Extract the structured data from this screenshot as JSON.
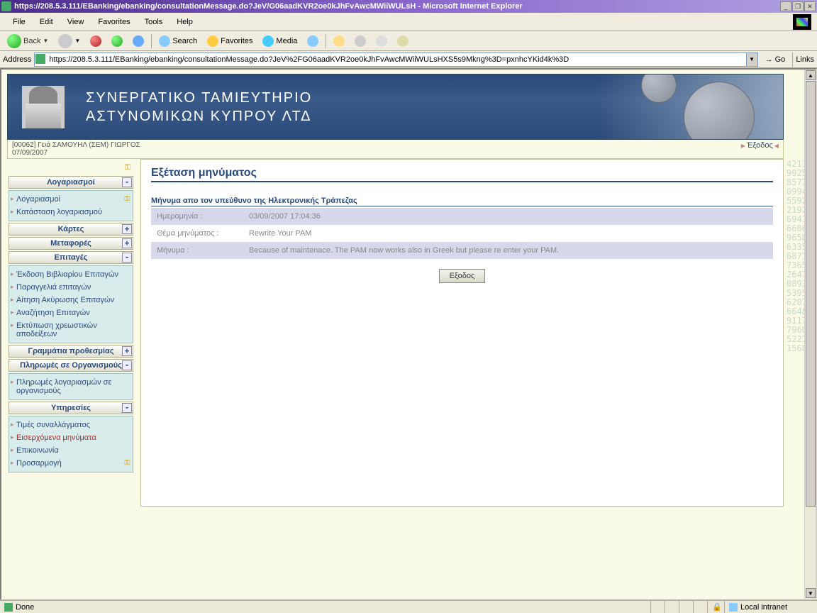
{
  "window": {
    "title": "https://208.5.3.111/EBanking/ebanking/consultationMessage.do?JeV/G06aadKVR2oe0kJhFvAwcMWiiWULsH - Microsoft Internet Explorer"
  },
  "menubar": [
    "File",
    "Edit",
    "View",
    "Favorites",
    "Tools",
    "Help"
  ],
  "toolbar": {
    "back": "Back",
    "search": "Search",
    "favorites": "Favorites",
    "media": "Media"
  },
  "addressbar": {
    "label": "Address",
    "url": "https://208.5.3.111/EBanking/ebanking/consultationMessage.do?JeV%2FG06aadKVR2oe0kJhFvAwcMWiiWULsHXS5s9Mkng%3D=pxnhcYKid4k%3D",
    "go": "Go",
    "links": "Links"
  },
  "banner": {
    "line1": "ΣΥΝΕΡΓΑΤΙΚΟ ΤΑΜΙΕΥΤΗΡΙΟ",
    "line2": "ΑΣΤΥΝΟΜΙΚΩΝ ΚΥΠΡΟΥ ΛΤΔ"
  },
  "greeting": {
    "line1": "[00062] Γειά ΣΑΜΟΥΗΛ (ΣΕΜ) ΓΙΩΡΓΟΣ",
    "line2": "07/09/2007",
    "exit": "Έξοδος"
  },
  "sidebar": {
    "sections": [
      {
        "header": "Λογαριασμοί",
        "toggle": "-",
        "items": [
          "Λογαριασμοί",
          "Κατάσταση λογαριασμού"
        ]
      },
      {
        "header": "Κάρτες",
        "toggle": "+"
      },
      {
        "header": "Μεταφορές",
        "toggle": "+"
      },
      {
        "header": "Επιταγές",
        "toggle": "-",
        "items": [
          "Έκδοση Βιβλιαρίου Επιταγών",
          "Παραγγελιά επιταγών",
          "Αίτηση Ακύρωσης Επιταγών",
          "Αναζήτηση Επιταγών",
          "Εκτύπωση χρεωστικών αποδείξεων"
        ]
      },
      {
        "header": "Γραμμάτια προθεσμίας",
        "toggle": "+"
      },
      {
        "header": "Πληρωμές σε Οργανισμούς",
        "toggle": "-",
        "items": [
          "Πληρωμές λογαριασμών σε οργανισμούς"
        ]
      },
      {
        "header": "Υπηρεσίες",
        "toggle": "-",
        "items": [
          "Τιμές συναλλάγματος",
          "Εισερχόμενα μηνύματα",
          "Επικοινωνία",
          "Προσαρμογή"
        ],
        "active_index": 1
      }
    ]
  },
  "content": {
    "title": "Εξέταση μηνύματος",
    "section_label": "Μήνυμα απο τον υπεύθυνο της Ηλεκτρονικής Τράπεζας",
    "rows": [
      {
        "label": "Ημερομηνία :",
        "value": "03/09/2007 17:04:36"
      },
      {
        "label": "Θέμα μηνύματος :",
        "value": "Rewrite Your PAM"
      },
      {
        "label": "Μήνυμα :",
        "value": "Because of maintenace. The PAM now works also in Greek but please re enter your PAM."
      }
    ],
    "exit_button": "Εξοδος"
  },
  "statusbar": {
    "done": "Done",
    "zone": "Local intranet"
  }
}
